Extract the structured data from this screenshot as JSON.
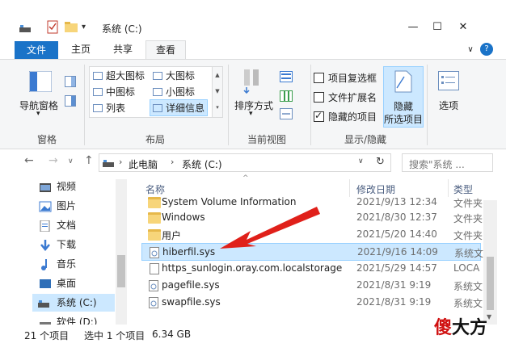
{
  "window": {
    "title": "系统 (C:)",
    "minimize": "—",
    "maximize": "☐",
    "close": "✕",
    "help": "?",
    "collapse": "∨"
  },
  "tabs": [
    "文件",
    "主页",
    "共享",
    "查看"
  ],
  "ribbon": {
    "nav_pane": "导航窗格",
    "group_pane": "窗格",
    "layout": {
      "xl_icons": "超大图标",
      "l_icons": "大图标",
      "m_icons": "中图标",
      "s_icons": "小图标",
      "list": "列表",
      "details": "详细信息",
      "group": "布局"
    },
    "sort": "排序方式",
    "group_current": "当前视图",
    "show": {
      "item_checkboxes": "项目复选框",
      "file_ext": "文件扩展名",
      "hidden_items": "隐藏的项目",
      "hide_selected_line1": "隐藏",
      "hide_selected_line2": "所选项目",
      "group": "显示/隐藏"
    },
    "options": "选项"
  },
  "address": {
    "path": [
      "此电脑",
      "系统 (C:)"
    ],
    "search_placeholder": "搜索\"系统 ..."
  },
  "nav_pane": {
    "items": [
      "视频",
      "图片",
      "文档",
      "下载",
      "音乐",
      "桌面",
      "系统 (C:)",
      "软件 (D:)"
    ]
  },
  "columns": {
    "name": "名称",
    "date": "修改日期",
    "type": "类型"
  },
  "files": [
    {
      "name": "System Volume Information",
      "date": "2021/9/13 12:34",
      "type": "文件夹",
      "kind": "folder"
    },
    {
      "name": "Windows",
      "date": "2021/8/30 12:37",
      "type": "文件夹",
      "kind": "folder"
    },
    {
      "name": "用户",
      "date": "2021/5/20 14:40",
      "type": "文件夹",
      "kind": "folder"
    },
    {
      "name": "hiberfil.sys",
      "date": "2021/9/16 14:09",
      "type": "系统文",
      "kind": "sys"
    },
    {
      "name": "https_sunlogin.oray.com.localstorage",
      "date": "2021/5/29 14:57",
      "type": "LOCA",
      "kind": "file"
    },
    {
      "name": "pagefile.sys",
      "date": "2021/8/31 9:19",
      "type": "系统文",
      "kind": "sys"
    },
    {
      "name": "swapfile.sys",
      "date": "2021/8/31 9:19",
      "type": "系统文",
      "kind": "sys"
    }
  ],
  "status": {
    "count": "21 个项目",
    "selected": "选中 1 个项目",
    "size": "6.34 GB"
  },
  "watermark": {
    "char1": "傻",
    "char2": "大方"
  },
  "colors": {
    "accent": "#1a73c8",
    "selection": "#cce8ff",
    "arrow": "#e0201a"
  }
}
